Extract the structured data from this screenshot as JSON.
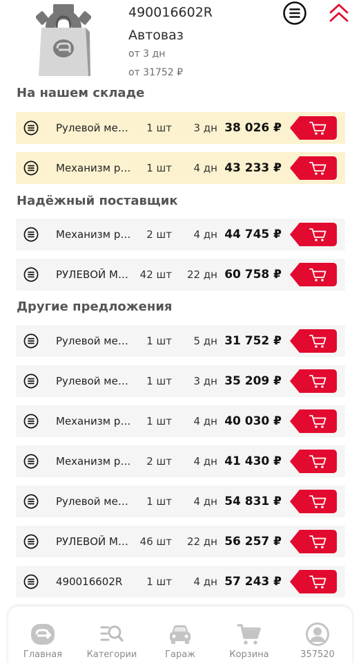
{
  "header": {
    "part_number": "490016602R",
    "brand": "Автоваз",
    "delivery": "от 3 дн",
    "price_from": "от 31752 ₽"
  },
  "icons": {
    "menu": "menu-circle-icon",
    "collapse": "chevron-double-up-icon",
    "info": "list-circle-icon",
    "cart": "cart-icon"
  },
  "colors": {
    "accent": "#e30a2f",
    "own_stock_row": "#fdf2cf",
    "row": "#f5f5f5",
    "nav_icon": "#bdbdbd"
  },
  "sections": [
    {
      "title": "На нашем складе",
      "offers": [
        {
          "name": "Рулевой механизм",
          "qty": "1 шт",
          "days": "3 дн",
          "price": "38 026 ₽"
        },
        {
          "name": "Механизм рулевой",
          "qty": "1 шт",
          "days": "4 дн",
          "price": "43 233 ₽"
        }
      ]
    },
    {
      "title": "Надёжный поставщик",
      "offers": [
        {
          "name": "Механизм рулевой",
          "qty": "2 шт",
          "days": "4 дн",
          "price": "44 745 ₽"
        },
        {
          "name": "РУЛЕВОЙ МЕХАНИЗМ",
          "qty": "42 шт",
          "days": "22 дн",
          "price": "60 758 ₽"
        }
      ]
    },
    {
      "title": "Другие предложения",
      "offers": [
        {
          "name": "Рулевой механизм",
          "qty": "1 шт",
          "days": "5 дн",
          "price": "31 752 ₽"
        },
        {
          "name": "Рулевой механизм",
          "qty": "1 шт",
          "days": "3 дн",
          "price": "35 209 ₽"
        },
        {
          "name": "Механизм рулевой",
          "qty": "1 шт",
          "days": "4 дн",
          "price": "40 030 ₽"
        },
        {
          "name": "Механизм рулевой",
          "qty": "2 шт",
          "days": "4 дн",
          "price": "41 430 ₽"
        },
        {
          "name": "Рулевой механизм",
          "qty": "1 шт",
          "days": "4 дн",
          "price": "54 831 ₽"
        },
        {
          "name": "РУЛЕВОЙ МЕХАНИЗМ",
          "qty": "46 шт",
          "days": "22 дн",
          "price": "56 257 ₽"
        },
        {
          "name": "490016602R",
          "qty": "1 шт",
          "days": "4 дн",
          "price": "57 243 ₽"
        }
      ]
    }
  ],
  "nav": [
    {
      "label": "Главная",
      "icon": "home-logo-icon"
    },
    {
      "label": "Категории",
      "icon": "categories-search-icon"
    },
    {
      "label": "Гараж",
      "icon": "car-icon"
    },
    {
      "label": "Корзина",
      "icon": "cart-icon"
    },
    {
      "label": "357520",
      "icon": "profile-icon"
    }
  ]
}
